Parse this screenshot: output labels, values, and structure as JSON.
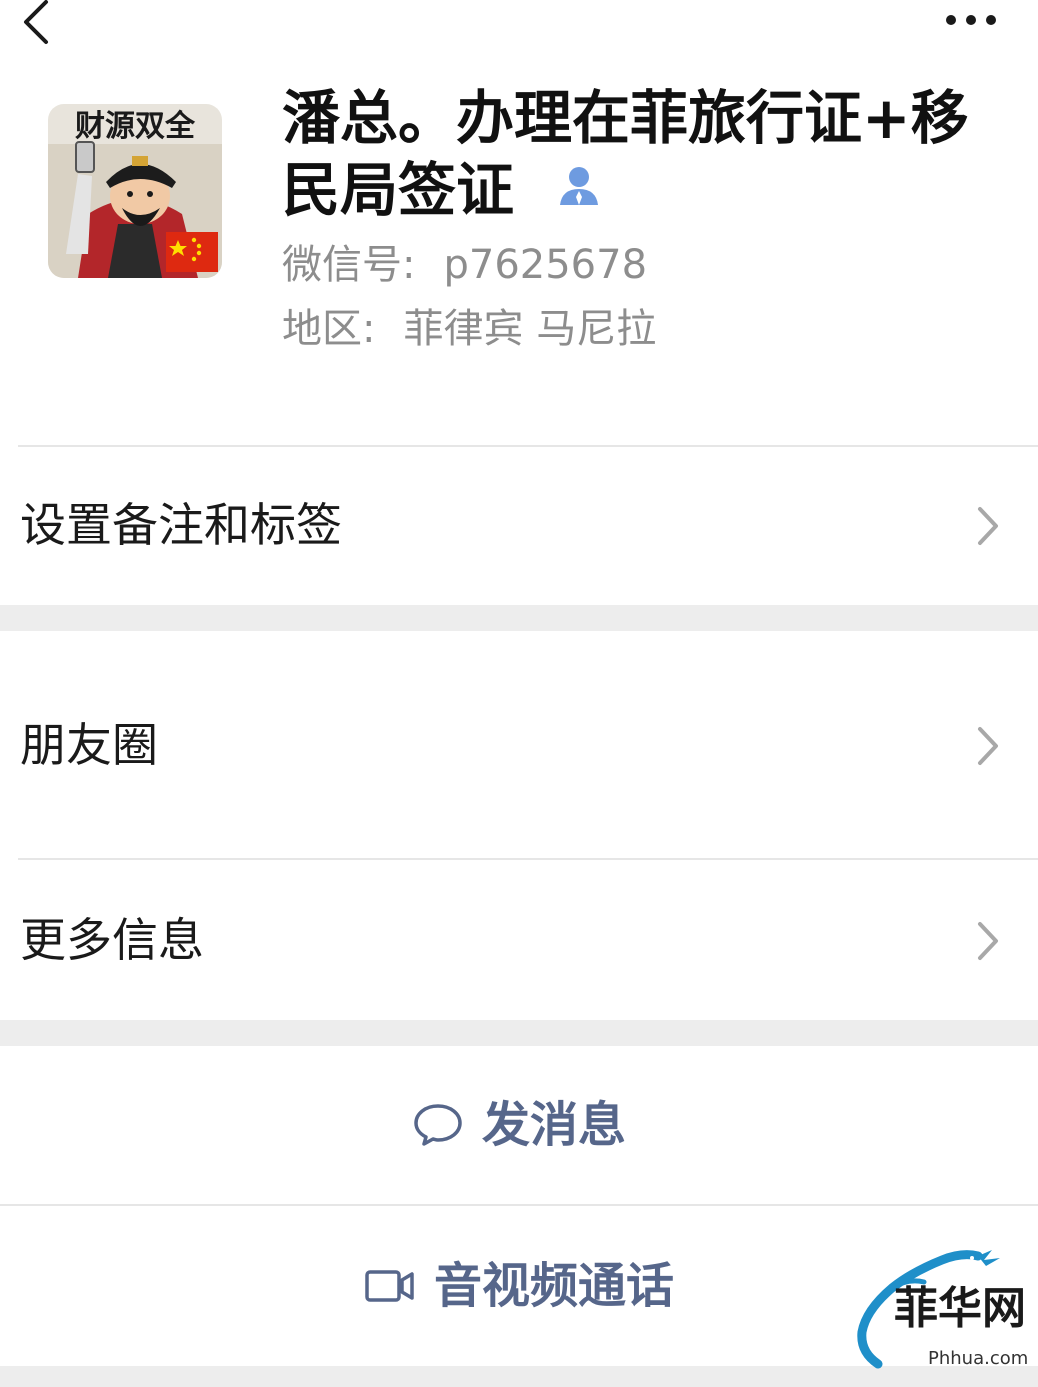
{
  "profile": {
    "name": "潘总。办理在菲旅行证+移民局签证",
    "wechat_id_label": "微信号:",
    "wechat_id": "p7625678",
    "region_label": "地区:",
    "region": "菲律宾 马尼拉"
  },
  "avatar": {
    "caption": "财源双全"
  },
  "menu": {
    "remark": "设置备注和标签",
    "moments": "朋友圈",
    "more_info": "更多信息"
  },
  "actions": {
    "message": "发消息",
    "call": "音视频通话"
  },
  "watermark": {
    "text": "菲华网",
    "url": "Phhua.com"
  },
  "colors": {
    "action_text": "#56668a",
    "secondary_text": "#8d8d8d",
    "section_gap": "#ededed",
    "divider": "#e6e6e6",
    "contact_icon": "#6e9be0"
  },
  "icons": {
    "back": "back-arrow-icon",
    "more": "more-dots-icon",
    "contact": "contact-person-icon",
    "chevron": "chevron-right-icon",
    "message": "chat-bubble-icon",
    "call": "video-camera-icon",
    "watermark": "dragon-logo-icon"
  }
}
